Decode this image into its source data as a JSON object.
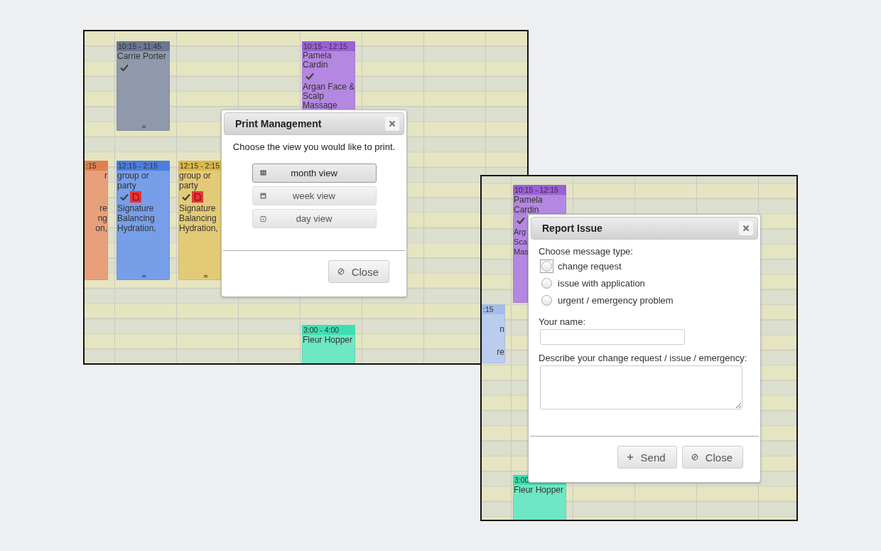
{
  "screens": [
    {
      "calendar": {
        "events": [
          {
            "time": "10:15 - 11:45",
            "color": "#6b7690",
            "title_lines": [
              "Carrie Porter"
            ],
            "checked": true,
            "document": false
          },
          {
            "time": "10:15 - 12:15",
            "color": "#9b5fd6",
            "title_lines": [
              "Pamela",
              "Cardin"
            ],
            "checked": true,
            "document": false,
            "service_lines": [
              "Argan Face &",
              "Scalp",
              "Massage"
            ]
          },
          {
            "time": ":15",
            "color": "#e0804f",
            "title_lines": [
              "r"
            ],
            "checked": false,
            "document": false,
            "service_lines": [
              "re",
              "ng",
              "on,"
            ]
          },
          {
            "time": "12:15 - 2:15",
            "color": "#4a7ee0",
            "title_lines": [
              "group or",
              "party"
            ],
            "checked": true,
            "document": true,
            "service_lines": [
              "Signature",
              "Balancing",
              "Hydration,"
            ]
          },
          {
            "time": "12:15 - 2:15",
            "color": "#dab84a",
            "title_lines": [
              "group or",
              "party"
            ],
            "checked": true,
            "document": true,
            "service_lines": [
              "Signature",
              "Balancing",
              "Hydration,"
            ]
          },
          {
            "time": "3:00 - 4:00",
            "color": "#3ddfb0",
            "title_lines": [
              "Fleur Hopper"
            ],
            "checked": false,
            "document": false
          }
        ]
      },
      "dialog": {
        "kind": "print",
        "title": "Print Management",
        "message": "Choose the view you would like to print.",
        "views": [
          {
            "label": "month view",
            "selected": true
          },
          {
            "label": "week view",
            "selected": false
          },
          {
            "label": "day view",
            "selected": false
          }
        ],
        "buttons": [
          {
            "label": "Close",
            "kind": "close"
          }
        ]
      }
    },
    {
      "calendar": {
        "events": [
          {
            "time": "10:15 - 12:15",
            "color": "#9b5fd6",
            "title_lines": [
              "Pamela",
              "Cardin"
            ],
            "checked": true,
            "document": false,
            "service_lines": [
              "Arg",
              "Sca",
              "Mas"
            ]
          },
          {
            "time": ":15",
            "color": "#a4bde8",
            "title_lines": [
              "n"
            ],
            "checked": false,
            "document": false,
            "service_lines": [
              "re"
            ]
          },
          {
            "time": "3:00",
            "color": "#3ddfb0",
            "title_lines": [
              "Fleur Hopper"
            ],
            "checked": false,
            "document": false
          }
        ]
      },
      "dialog": {
        "kind": "report",
        "title": "Report Issue",
        "type_label": "Choose message type:",
        "types": [
          {
            "label": "change request",
            "selected": false,
            "focused": true
          },
          {
            "label": "issue with application",
            "selected": false,
            "focused": false
          },
          {
            "label": "urgent / emergency problem",
            "selected": false,
            "focused": false
          }
        ],
        "name_label": "Your name:",
        "description_label": "Describe your change request / issue / emergency:",
        "buttons": [
          {
            "label": "Send",
            "kind": "send"
          },
          {
            "label": "Close",
            "kind": "close"
          }
        ]
      }
    }
  ]
}
